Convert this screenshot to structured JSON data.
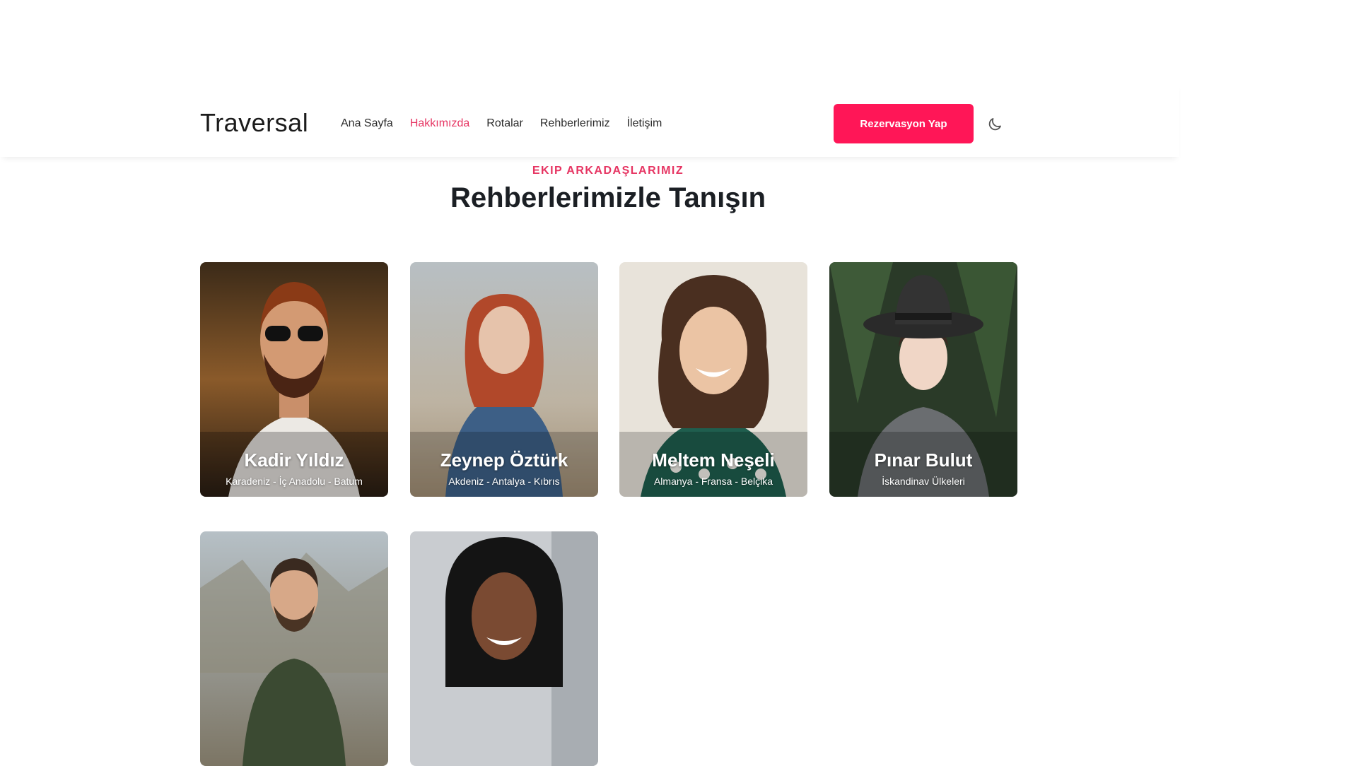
{
  "header": {
    "brand": "Traversal",
    "nav": [
      "Ana Sayfa",
      "Hakkımızda",
      "Rotalar",
      "Rehberlerimiz",
      "İletişim"
    ],
    "cta": "Rezervasyon Yap",
    "theme_icon": "moon-icon",
    "accent": "#e63462",
    "button_color": "#ff1657"
  },
  "section": {
    "eyebrow": "EKIP ARKADAŞLARIMIZ",
    "title": "Rehberlerimizle Tanışın"
  },
  "guides": [
    {
      "name": "Kadir Yıldız",
      "routes": "Karadeniz - İç Anadolu - Batum"
    },
    {
      "name": "Zeynep Öztürk",
      "routes": "Akdeniz - Antalya - Kıbrıs"
    },
    {
      "name": "Meltem Neşeli",
      "routes": "Almanya - Fransa - Belçika"
    },
    {
      "name": "Pınar Bulut",
      "routes": "İskandinav Ülkeleri"
    },
    {
      "name": "",
      "routes": ""
    },
    {
      "name": "",
      "routes": ""
    }
  ]
}
